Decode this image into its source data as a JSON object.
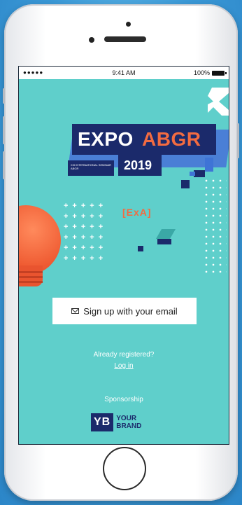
{
  "statusbar": {
    "carrier": "●●●●● ",
    "time": "9:41 AM",
    "battery": "100%"
  },
  "poster": {
    "title_left": "EXPO",
    "title_right": "ABGR",
    "year": "2019",
    "subtitle": "XIII INTERNATIONAL SEMINAR ABGR",
    "logo": "[ExA]"
  },
  "actions": {
    "email_signup": "Sign up with your email",
    "already_registered": "Already registered?",
    "login": "Log in"
  },
  "sponsorship": {
    "label": "Sponsorship",
    "logo_mark": "YB",
    "logo_text_1": "YOUR",
    "logo_text_2": "BRAND"
  },
  "colors": {
    "screen_bg": "#5fcfcb",
    "navy": "#1b2a6b",
    "accent": "#f26b41"
  }
}
